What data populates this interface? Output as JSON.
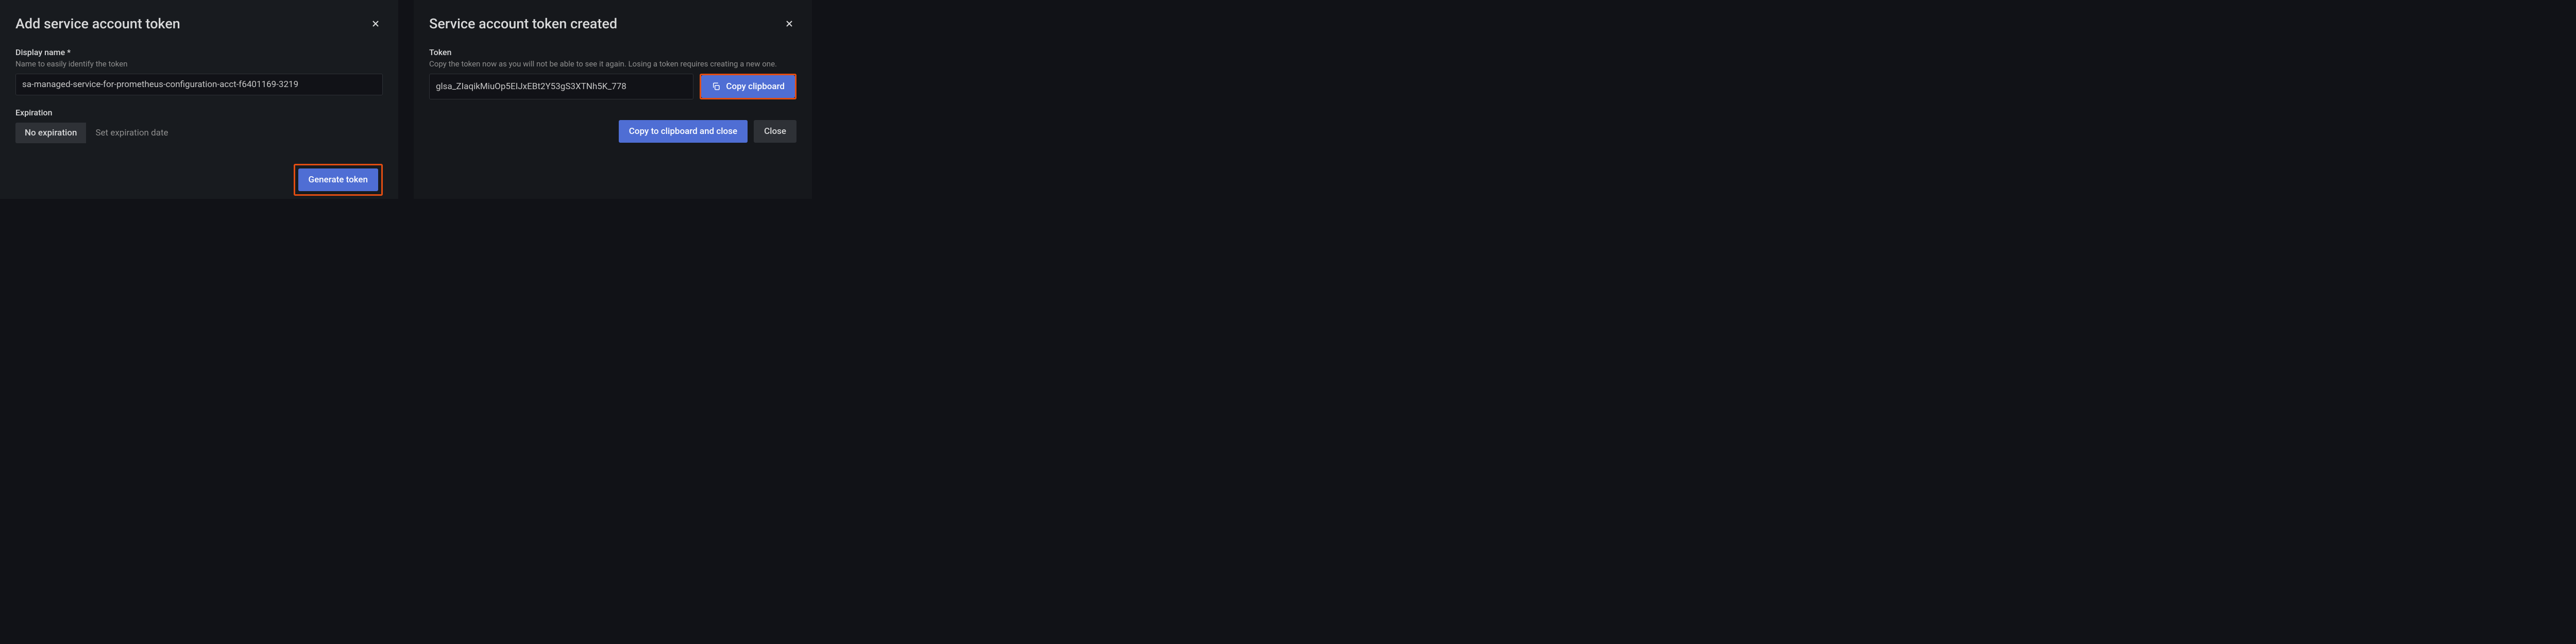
{
  "left": {
    "title": "Add service account token",
    "display_name": {
      "label": "Display name *",
      "hint": "Name to easily identify the token",
      "value": "sa-managed-service-for-prometheus-configuration-acct-f6401169-3219"
    },
    "expiration": {
      "label": "Expiration",
      "options": {
        "no_expiration": "No expiration",
        "set_date": "Set expiration date"
      }
    },
    "generate": "Generate token"
  },
  "right": {
    "title": "Service account token created",
    "token": {
      "label": "Token",
      "hint": "Copy the token now as you will not be able to see it again. Losing a token requires creating a new one.",
      "value": "glsa_ZIaqikMiuOp5EIJxEBt2Y53gS3XTNh5K_778"
    },
    "copy_clipboard": "Copy clipboard",
    "copy_close": "Copy to clipboard and close",
    "close": "Close"
  }
}
